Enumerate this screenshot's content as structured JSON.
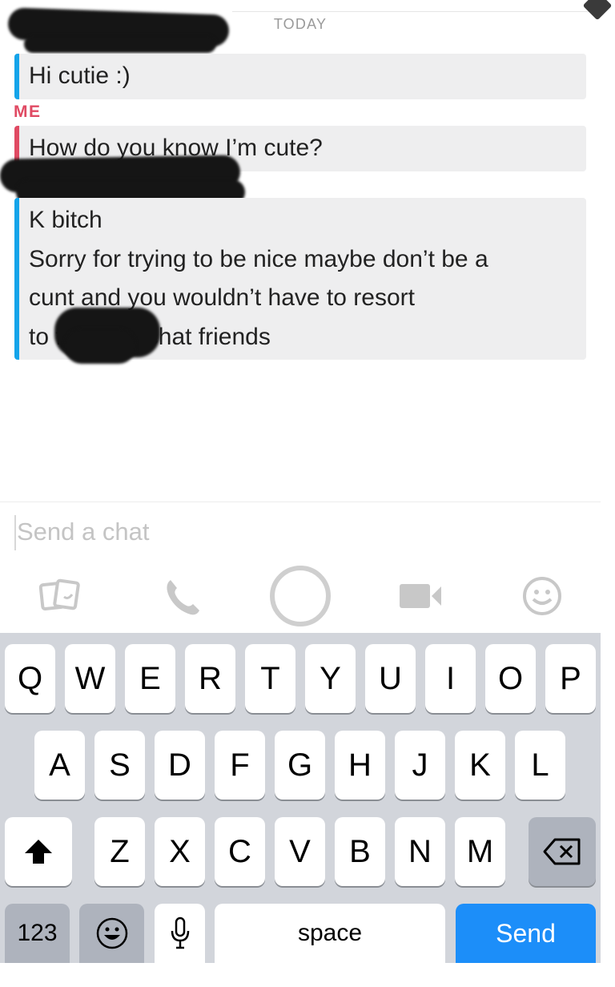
{
  "chat": {
    "date_label": "TODAY",
    "me_label": "ME",
    "messages": [
      {
        "lines": [
          "Hi cutie :)"
        ]
      },
      {
        "lines": [
          "How do you know I’m cute?"
        ]
      },
      {
        "lines": [
          "K bitch",
          "Sorry for trying to be nice maybe don’t be a",
          "cunt and you wouldn’t have to resort",
          "to            for Snapchat friends"
        ]
      }
    ]
  },
  "compose": {
    "placeholder": "Send a chat"
  },
  "actions": [
    "memories-icon",
    "phone-icon",
    "capture-ring-icon",
    "video-camera-icon",
    "emoji-icon"
  ],
  "keyboard": {
    "row1": [
      "Q",
      "W",
      "E",
      "R",
      "T",
      "Y",
      "U",
      "I",
      "O",
      "P"
    ],
    "row2": [
      "A",
      "S",
      "D",
      "F",
      "G",
      "H",
      "J",
      "K",
      "L"
    ],
    "row3": [
      "Z",
      "X",
      "C",
      "V",
      "B",
      "N",
      "M"
    ],
    "numbers_label": "123",
    "space_label": "space",
    "send_label": "Send"
  },
  "colors": {
    "friend_accent": "#14a4ea",
    "me_accent": "#e04a63",
    "send_key": "#1c8ef9"
  }
}
